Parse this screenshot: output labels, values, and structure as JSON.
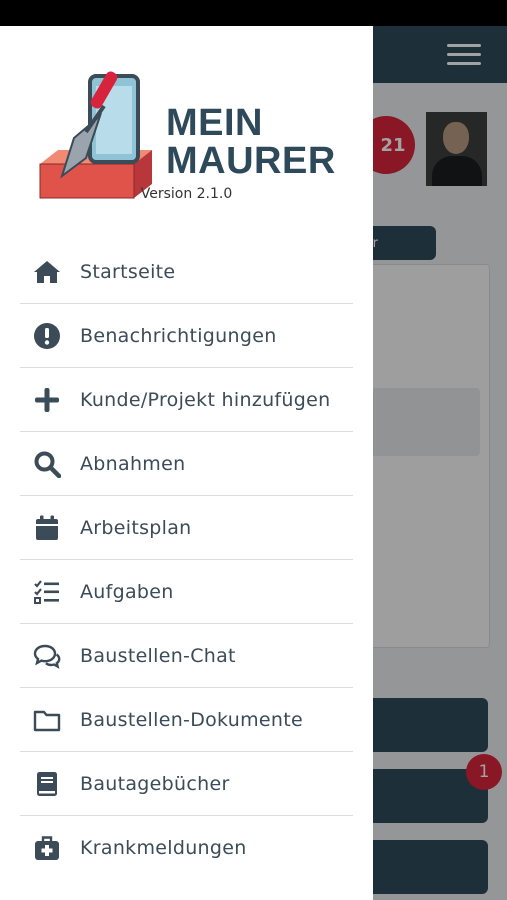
{
  "colors": {
    "brand": "#2e4a5a",
    "accent_red": "#d7243c",
    "icon": "#3b4b57"
  },
  "app": {
    "logo_line1": "MEIN",
    "logo_line2": "MAURER",
    "version": "Version 2.1.0"
  },
  "background": {
    "badge_count": "21",
    "pill_text": "r",
    "notification_count": "1"
  },
  "menu": {
    "items": [
      {
        "label": "Startseite",
        "icon": "home-icon"
      },
      {
        "label": "Benachrichtigungen",
        "icon": "alert-circle-icon"
      },
      {
        "label": "Kunde/Projekt hinzufügen",
        "icon": "plus-icon"
      },
      {
        "label": "Abnahmen",
        "icon": "search-icon"
      },
      {
        "label": "Arbeitsplan",
        "icon": "calendar-icon"
      },
      {
        "label": "Aufgaben",
        "icon": "task-list-icon"
      },
      {
        "label": "Baustellen-Chat",
        "icon": "chat-bubbles-icon"
      },
      {
        "label": "Baustellen-Dokumente",
        "icon": "folder-icon"
      },
      {
        "label": "Bautagebücher",
        "icon": "book-icon"
      },
      {
        "label": "Krankmeldungen",
        "icon": "medical-case-icon"
      }
    ]
  }
}
